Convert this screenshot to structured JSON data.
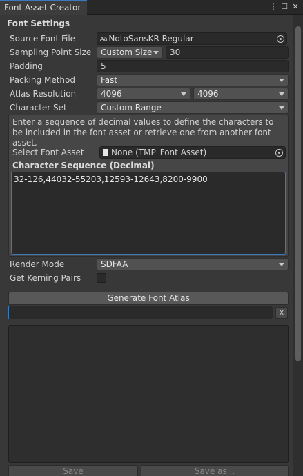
{
  "window": {
    "tab_title": "Font Asset Creator",
    "controls": {
      "menu": "⋮",
      "maximize": "☐",
      "close": "✕"
    }
  },
  "font_settings": {
    "title": "Font Settings",
    "source_font_file": {
      "label": "Source Font File",
      "value": "NotoSansKR-Regular",
      "icon": "font-asset-icon",
      "icon_glyph": "Aa"
    },
    "sampling_point_size": {
      "label": "Sampling Point Size",
      "mode": "Custom Size",
      "value": "30"
    },
    "padding": {
      "label": "Padding",
      "value": "5"
    },
    "packing_method": {
      "label": "Packing Method",
      "value": "Fast"
    },
    "atlas_resolution": {
      "label": "Atlas Resolution",
      "width": "4096",
      "height": "4096"
    },
    "character_set": {
      "label": "Character Set",
      "value": "Custom Range"
    }
  },
  "custom_range": {
    "help_text": "Enter a sequence of decimal values to define the characters to be included in the font asset or retrieve one from another font asset.",
    "select_font_asset": {
      "label": "Select Font Asset",
      "value": "None (TMP_Font Asset)"
    },
    "sequence_header": "Character Sequence (Decimal)",
    "sequence_value": "32-126,44032-55203,12593-12643,8200-9900"
  },
  "render_mode": {
    "label": "Render Mode",
    "value": "SDFAA"
  },
  "kerning": {
    "label": "Get Kerning Pairs",
    "checked": false
  },
  "actions": {
    "generate": "Generate Font Atlas",
    "clear": "X",
    "save": "Save",
    "save_as": "Save as..."
  },
  "colors": {
    "accent": "#3a79bb",
    "background": "#383838",
    "field_bg": "#2a2a2a",
    "button_bg": "#585858"
  }
}
